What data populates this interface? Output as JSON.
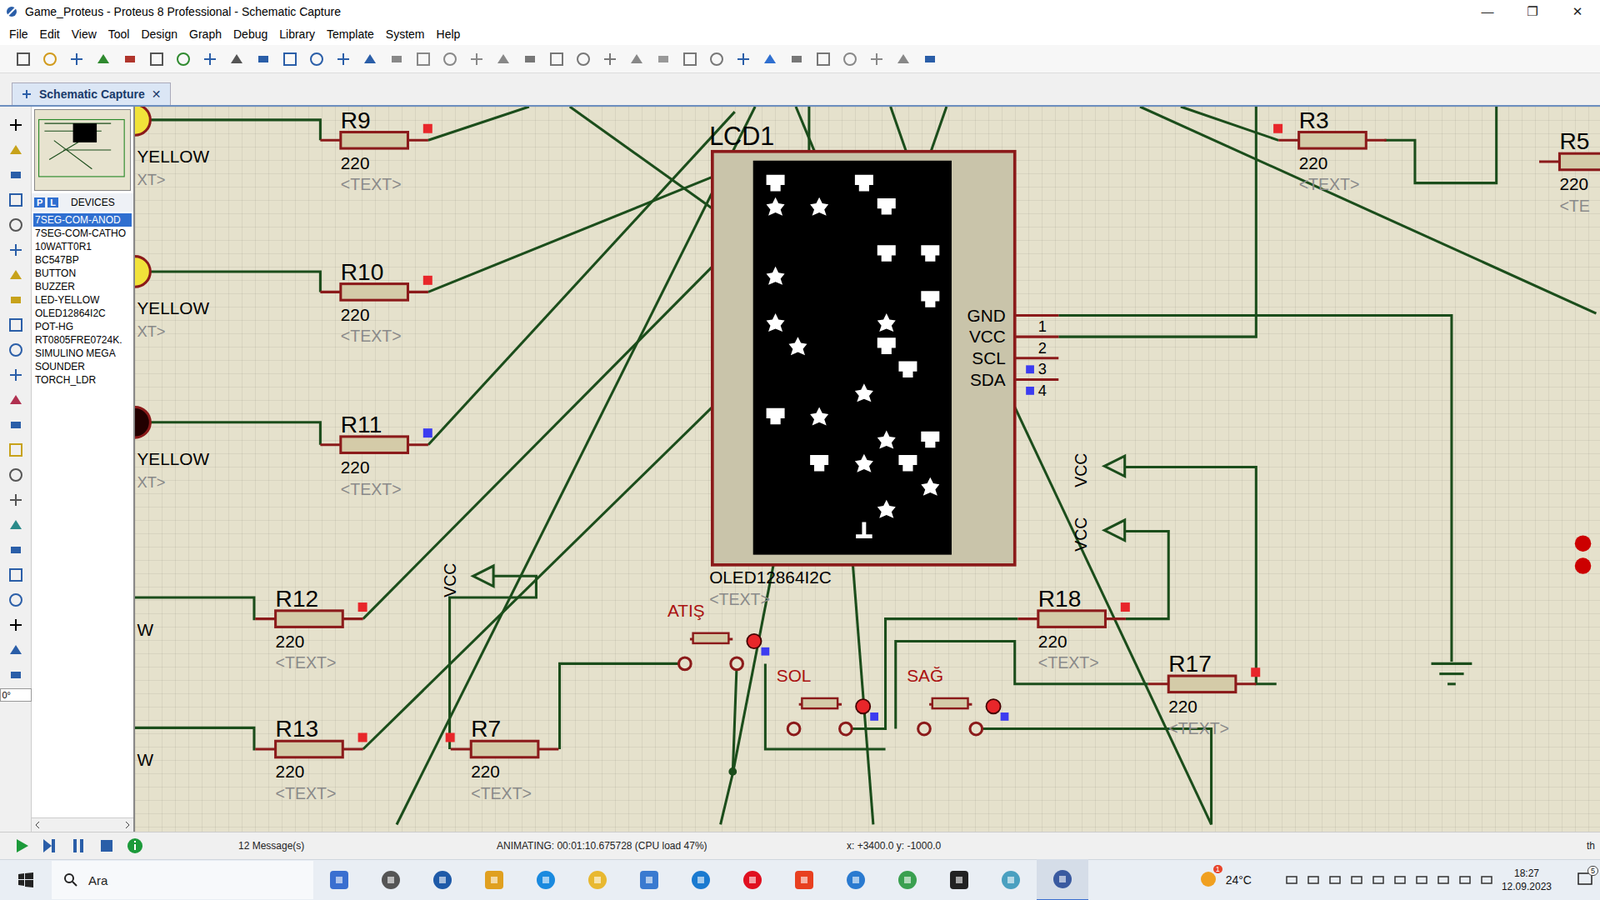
{
  "window": {
    "title": "Game_Proteus - Proteus 8 Professional - Schematic Capture",
    "controls": [
      "—",
      "❐",
      "✕"
    ]
  },
  "menu": [
    "File",
    "Edit",
    "View",
    "Tool",
    "Design",
    "Graph",
    "Debug",
    "Library",
    "Template",
    "System",
    "Help"
  ],
  "tabs": [
    {
      "label": "Schematic Capture",
      "selected": true,
      "close": "✕"
    }
  ],
  "devices": {
    "modes": [
      {
        "label": "P",
        "selected": true
      },
      {
        "label": "L",
        "selected": true
      }
    ],
    "title": "DEVICES",
    "items": [
      {
        "label": "7SEG-COM-ANOD",
        "selected": true
      },
      {
        "label": "7SEG-COM-CATHO",
        "selected": false
      },
      {
        "label": "10WATT0R1",
        "selected": false
      },
      {
        "label": "BC547BP",
        "selected": false
      },
      {
        "label": "BUTTON",
        "selected": false
      },
      {
        "label": "BUZZER",
        "selected": false
      },
      {
        "label": "LED-YELLOW",
        "selected": false
      },
      {
        "label": "OLED12864I2C",
        "selected": false
      },
      {
        "label": "POT-HG",
        "selected": false
      },
      {
        "label": "RT0805FRE0724K.",
        "selected": false
      },
      {
        "label": "SIMULINO MEGA",
        "selected": false
      },
      {
        "label": "SOUNDER",
        "selected": false
      },
      {
        "label": "TORCH_LDR",
        "selected": false
      }
    ]
  },
  "rotation": "0°",
  "schematic": {
    "leds": [
      {
        "label": "YELLOW",
        "text": "XT>",
        "lit": true
      },
      {
        "label": "YELLOW",
        "text": "XT>",
        "lit": true
      },
      {
        "label": "YELLOW",
        "text": "XT>",
        "lit": false
      }
    ],
    "cut_labels": [
      "W",
      "W"
    ],
    "resistors": [
      {
        "name": "R9",
        "value": "220",
        "text": "<TEXT>",
        "probe": "#e8262a"
      },
      {
        "name": "R10",
        "value": "220",
        "text": "<TEXT>",
        "probe": "#e8262a"
      },
      {
        "name": "R11",
        "value": "220",
        "text": "<TEXT>",
        "probe": "#3c3cf0"
      },
      {
        "name": "R12",
        "value": "220",
        "text": "<TEXT>",
        "probe": "#e8262a"
      },
      {
        "name": "R13",
        "value": "220",
        "text": "<TEXT>",
        "probe": "#e8262a"
      },
      {
        "name": "R7",
        "value": "220",
        "text": "<TEXT>",
        "probe": "#e8262a"
      },
      {
        "name": "R18",
        "value": "220",
        "text": "<TEXT>",
        "probe": "#e8262a"
      },
      {
        "name": "R17",
        "value": "220",
        "text": "<TEXT>",
        "probe": "#e8262a"
      },
      {
        "name": "R3",
        "value": "220",
        "text": "<TEXT>",
        "probe": "#e8262a"
      },
      {
        "name": "R5",
        "value": "220",
        "text": "<TE",
        "probe": null
      }
    ],
    "lcd": {
      "ref": "LCD1",
      "part": "OLED12864I2C",
      "text": "<TEXT>",
      "on": true,
      "pins": [
        {
          "name": "GND",
          "number": "1",
          "probe": null
        },
        {
          "name": "VCC",
          "number": "2",
          "probe": null
        },
        {
          "name": "SCL",
          "number": "3",
          "probe": "#3c3cf0"
        },
        {
          "name": "SDA",
          "number": "4",
          "probe": "#3c3cf0"
        }
      ]
    },
    "buttons": [
      {
        "label": "ATIŞ",
        "pressed": false,
        "state": "#e8262a",
        "probe": "#3c3cf0"
      },
      {
        "label": "SOL",
        "pressed": false,
        "state": "#e8262a",
        "probe": "#3c3cf0"
      },
      {
        "label": "SAĞ",
        "pressed": false,
        "state": "#e8262a",
        "probe": "#3c3cf0"
      }
    ],
    "power": [
      "VCC",
      "VCC",
      "VCC"
    ]
  },
  "status_bar": {
    "messages": "12 Message(s)",
    "animating": "ANIMATING: 00:01:10.675728 (CPU load 47%)",
    "x_label": "x:",
    "x": "+3400.0",
    "y_label": "y:",
    "y": "-1000.0",
    "tail": "th"
  },
  "taskbar": {
    "search": "Ara",
    "weather": "24°C",
    "weather_badge": "1",
    "time": "18:27",
    "date": "12.09.2023",
    "notifications": "5"
  }
}
